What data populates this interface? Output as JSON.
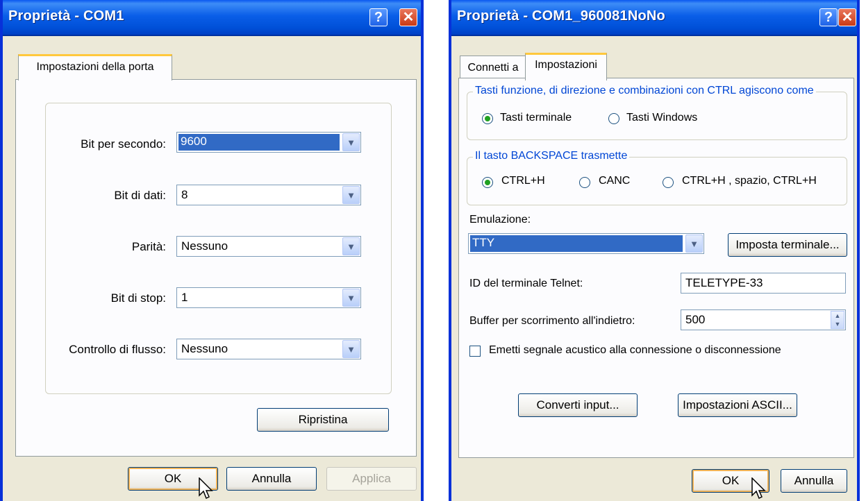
{
  "window1": {
    "title": "Proprietà - COM1",
    "help_glyph": "?",
    "close_glyph": "✕",
    "tab": "Impostazioni della porta",
    "fields": [
      {
        "label": "Bit per secondo:",
        "value": "9600"
      },
      {
        "label": "Bit di dati:",
        "value": "8"
      },
      {
        "label": "Parità:",
        "value": "Nessuno"
      },
      {
        "label": "Bit di stop:",
        "value": "1"
      },
      {
        "label": "Controllo di flusso:",
        "value": "Nessuno"
      }
    ],
    "restore_button": "Ripristina",
    "ok_button": "OK",
    "cancel_button": "Annulla",
    "apply_button": "Applica"
  },
  "window2": {
    "title": "Proprietà - COM1_960081NoNo",
    "help_glyph": "?",
    "close_glyph": "✕",
    "tabs": [
      "Connetti a",
      "Impostazioni"
    ],
    "group1": {
      "legend": "Tasti funzione, di direzione e combinazioni con CTRL agiscono come",
      "options": [
        "Tasti terminale",
        "Tasti Windows"
      ],
      "selected": 0
    },
    "group2": {
      "legend": "Il tasto BACKSPACE trasmette",
      "options": [
        "CTRL+H",
        "CANC",
        "CTRL+H , spazio, CTRL+H"
      ],
      "selected": 0
    },
    "emulation_label": "Emulazione:",
    "emulation_value": "TTY",
    "terminal_setup_button": "Imposta terminale...",
    "telnet_label": "ID del terminale Telnet:",
    "telnet_value": "TELETYPE-33",
    "buffer_label": "Buffer per scorrimento all'indietro:",
    "buffer_value": "500",
    "beep_checkbox": "Emetti segnale acustico alla connessione o disconnessione",
    "beep_checked": false,
    "convert_input_button": "Converti input...",
    "ascii_settings_button": "Impostazioni ASCII...",
    "ok_button": "OK",
    "cancel_button": "Annulla"
  },
  "colors": {
    "titlebar": "#0a5ee8",
    "dialog_bg": "#ece9d8",
    "selection": "#316ac5",
    "legend_text": "#0046d5",
    "radio_dot": "#21a121"
  }
}
